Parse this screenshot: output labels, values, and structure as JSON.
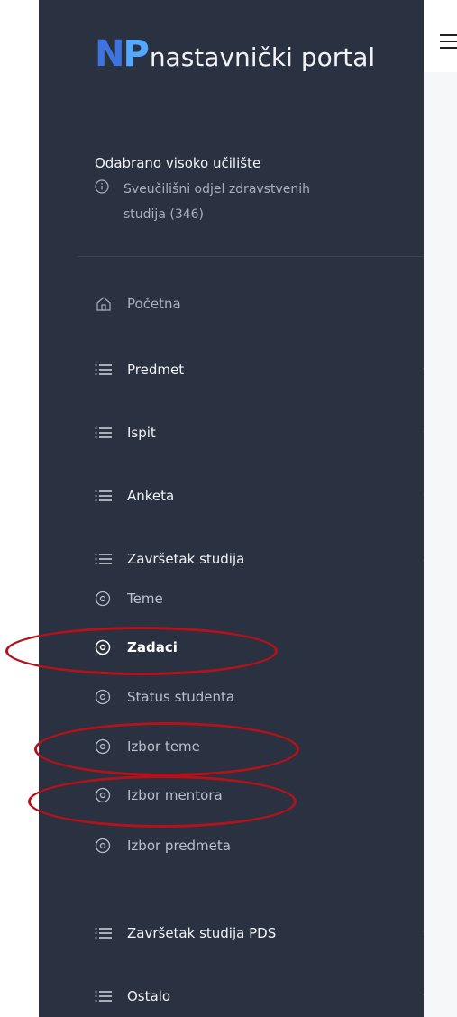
{
  "app": {
    "logo_mark_n": "N",
    "logo_mark_p": "P",
    "logo_text": "nastavnički portal"
  },
  "sidebar": {
    "section_label": "Odabrano visoko učilište",
    "selected_institution": "Sveučilišni odjel zdravstvenih studija (346)",
    "nav": [
      {
        "label": "Početna",
        "icon": "home-icon",
        "has_children": false
      },
      {
        "label": "Predmet",
        "icon": "list-icon",
        "has_children": true,
        "expanded": false
      },
      {
        "label": "Ispit",
        "icon": "list-icon",
        "has_children": true,
        "expanded": false
      },
      {
        "label": "Anketa",
        "icon": "list-icon",
        "has_children": true,
        "expanded": false
      },
      {
        "label": "Završetak studija",
        "icon": "list-icon",
        "has_children": true,
        "expanded": true,
        "children": [
          {
            "label": "Teme",
            "active": false,
            "highlighted": false
          },
          {
            "label": "Zadaci",
            "active": true,
            "highlighted": true
          },
          {
            "label": "Status studenta",
            "active": false,
            "highlighted": false
          },
          {
            "label": "Izbor teme",
            "active": false,
            "highlighted": true
          },
          {
            "label": "Izbor mentora",
            "active": false,
            "highlighted": true
          },
          {
            "label": "Izbor predmeta",
            "active": false,
            "highlighted": false
          }
        ]
      },
      {
        "label": "Završetak studija PDS",
        "icon": "list-icon",
        "has_children": true,
        "expanded": false
      },
      {
        "label": "Ostalo",
        "icon": "list-icon",
        "has_children": true,
        "expanded": false
      }
    ]
  },
  "colors": {
    "sidebar_bg": "#2a3140",
    "logo_blue": "#3d74e0",
    "logo_light_blue": "#54a8ff",
    "annotation_red": "#b3121a"
  }
}
